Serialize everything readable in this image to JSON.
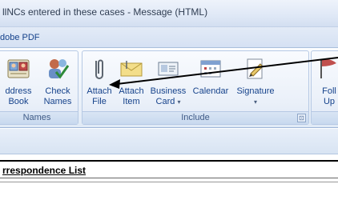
{
  "window": {
    "title": "llNCs entered in these cases - Message (HTML)"
  },
  "tabs": {
    "active": "dobe PDF"
  },
  "ribbon": {
    "groups": [
      {
        "name": "Names",
        "buttons": [
          {
            "label1": "ddress",
            "label2": "Book",
            "icon": "address-book-icon"
          },
          {
            "label1": "Check",
            "label2": "Names",
            "icon": "check-names-icon"
          }
        ]
      },
      {
        "name": "Include",
        "buttons": [
          {
            "label1": "Attach",
            "label2": "File",
            "icon": "paperclip-icon"
          },
          {
            "label1": "Attach",
            "label2": "Item",
            "icon": "envelope-icon"
          },
          {
            "label1": "Business",
            "label2": "Card",
            "icon": "business-card-icon",
            "dropdown": "▾"
          },
          {
            "label1": "Calendar",
            "label2": "",
            "icon": "calendar-icon"
          },
          {
            "label1": "Signature",
            "label2": "",
            "icon": "signature-icon",
            "dropdown": "▾"
          }
        ]
      },
      {
        "name": "",
        "buttons": [
          {
            "label1": "Foll",
            "label2": "Up",
            "icon": "flag-icon"
          }
        ]
      }
    ],
    "launcher_glyph": "⊡"
  },
  "document": {
    "heading": "rrespondence List"
  },
  "colors": {
    "ribbon_text": "#15428b",
    "caption_text": "#3e5a86",
    "accent": "#c0504d"
  }
}
